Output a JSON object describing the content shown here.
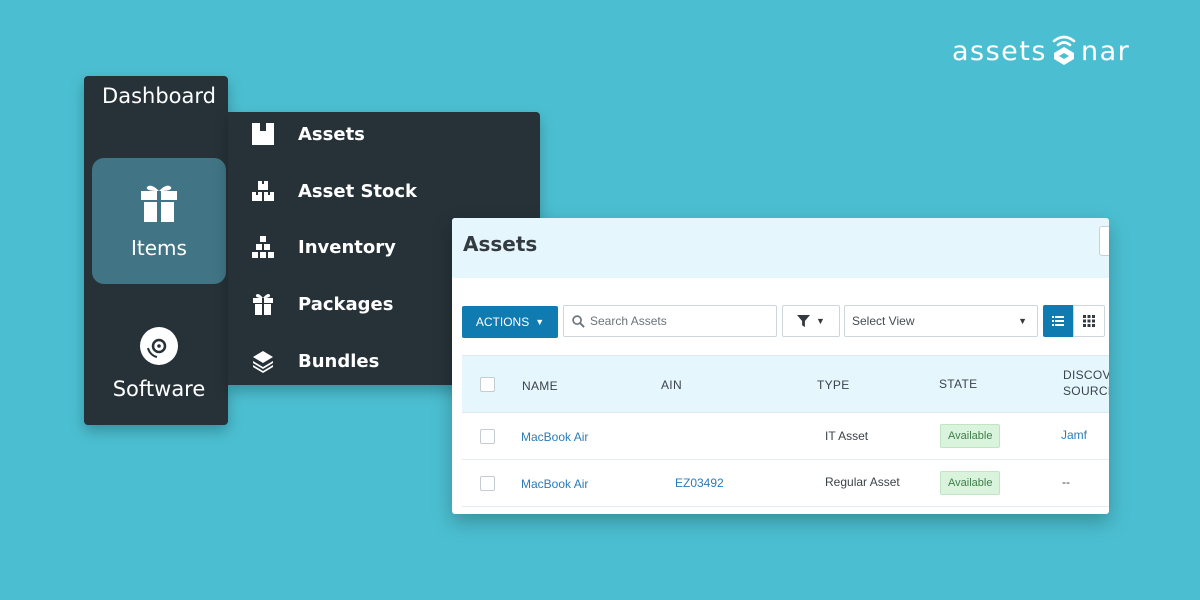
{
  "brand": {
    "text_before": "assets",
    "text_after": "nar",
    "icon": "sonar-logo-icon"
  },
  "sidebar": {
    "dashboard_label": "Dashboard",
    "items_label": "Items",
    "software_label": "Software"
  },
  "submenu": {
    "items": [
      {
        "label": "Assets",
        "icon": "box-icon"
      },
      {
        "label": "Asset Stock",
        "icon": "boxes-stack-icon"
      },
      {
        "label": "Inventory",
        "icon": "boxes-pyramid-icon"
      },
      {
        "label": "Packages",
        "icon": "gift-icon"
      },
      {
        "label": "Bundles",
        "icon": "layers-icon"
      }
    ]
  },
  "panel": {
    "title": "Assets",
    "actions_label": "ACTIONS",
    "search_placeholder": "Search Assets",
    "select_view_label": "Select View"
  },
  "table": {
    "columns": [
      "NAME",
      "AIN",
      "TYPE",
      "STATE",
      "DISCOVE",
      "SOURCE"
    ],
    "rows": [
      {
        "name": "MacBook Air",
        "ain": "",
        "type": "IT Asset",
        "state": "Available",
        "source": "Jamf"
      },
      {
        "name": "MacBook Air",
        "ain": "EZ03492",
        "type": "Regular Asset",
        "state": "Available",
        "source": "--"
      }
    ]
  },
  "colors": {
    "background": "#4bbfd1",
    "sidebar": "#263238",
    "sidebar_active": "#417585",
    "primary": "#0f7bb0",
    "link": "#2c7bb8",
    "badge_bg": "#d9f3dc"
  }
}
